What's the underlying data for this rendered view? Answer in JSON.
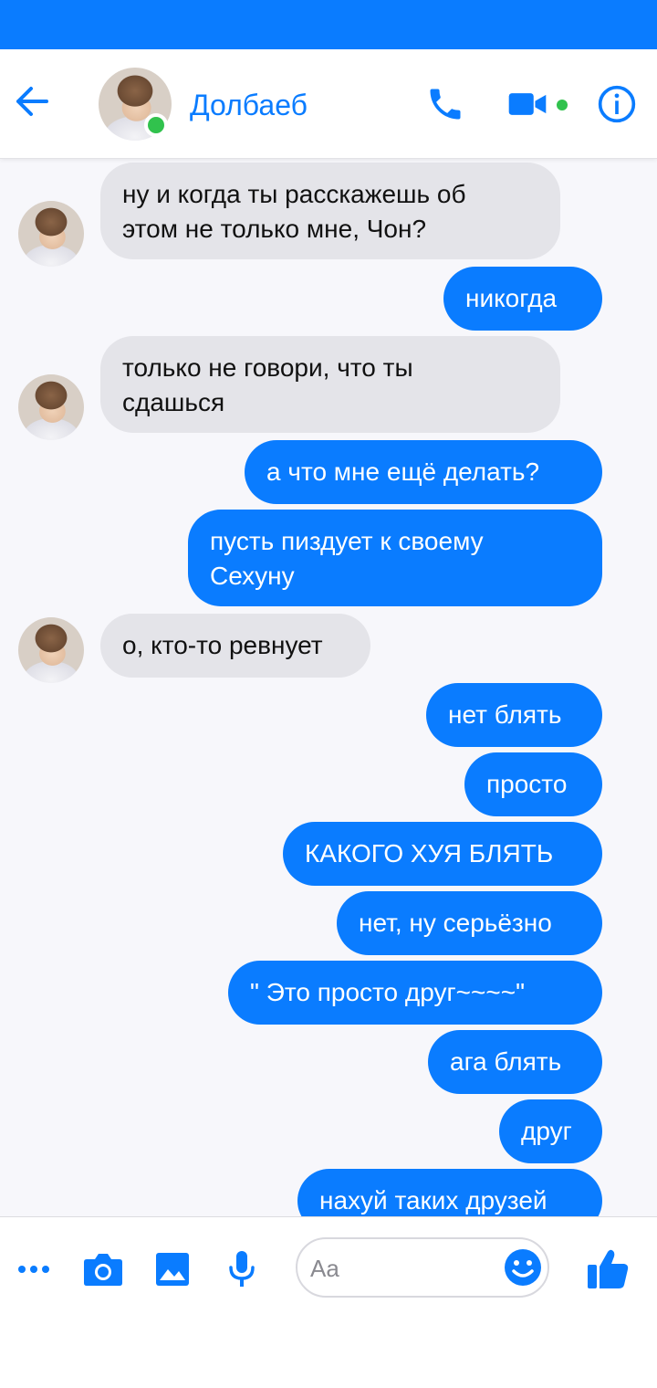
{
  "header": {
    "contact_name": "Долбаеб",
    "online": true
  },
  "colors": {
    "accent": "#0a7cff",
    "online": "#31c24d",
    "received_bubble": "#e4e4e9"
  },
  "messages": [
    {
      "from": "them",
      "text": "ну и когда ты расскажешь об\nэтом не только мне, Чон?"
    },
    {
      "from": "me",
      "text": "никогда"
    },
    {
      "from": "them",
      "text": "только не говори, что ты\nсдашься"
    },
    {
      "from": "me",
      "text": "а что мне ещё делать?"
    },
    {
      "from": "me",
      "text": "пусть пиздует к своему\nСехуну"
    },
    {
      "from": "them",
      "text": "о, кто-то ревнует"
    },
    {
      "from": "me",
      "text": "нет блять"
    },
    {
      "from": "me",
      "text": "просто"
    },
    {
      "from": "me",
      "text": "КАКОГО ХУЯ БЛЯТЬ"
    },
    {
      "from": "me",
      "text": "нет, ну серьёзно"
    },
    {
      "from": "me",
      "text": "\" Это просто друг~~~~\""
    },
    {
      "from": "me",
      "text": "ага блять"
    },
    {
      "from": "me",
      "text": "друг"
    },
    {
      "from": "me",
      "text": "нахуй таких друзей"
    }
  ],
  "composer": {
    "placeholder": "Aa",
    "icons": [
      "more-icon",
      "camera-icon",
      "image-icon",
      "microphone-icon",
      "emoji-icon",
      "thumbs-up-icon"
    ]
  }
}
